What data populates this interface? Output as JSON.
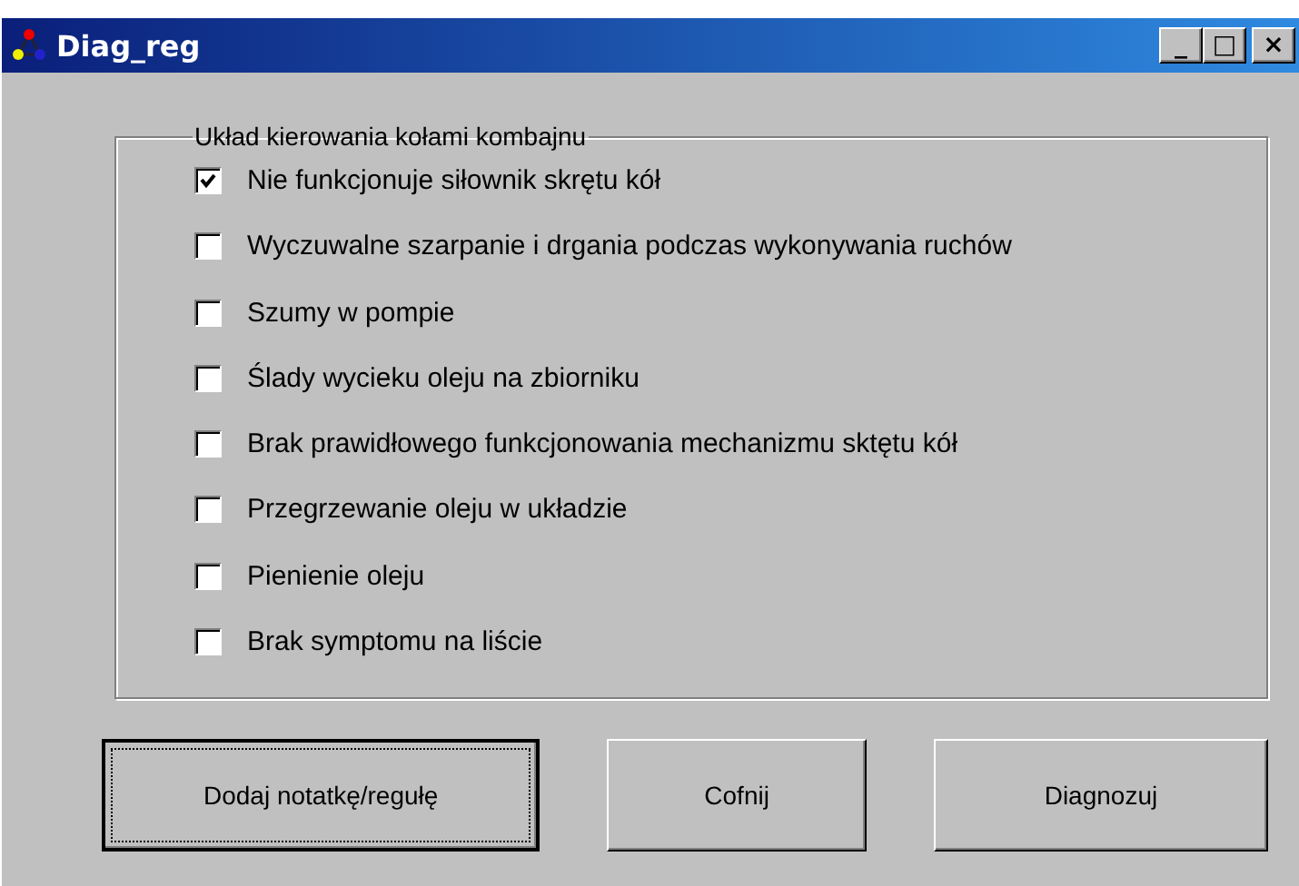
{
  "window": {
    "title": "Diag_reg",
    "controls": [
      "_",
      "□",
      "×"
    ]
  },
  "group": {
    "title": "Układ kierowania kołami kombajnu",
    "options": [
      {
        "label": "Nie funkcjonuje siłownik skrętu kół",
        "checked": true
      },
      {
        "label": "Wyczuwalne szarpanie i drgania podczas wykonywania ruchów",
        "checked": false
      },
      {
        "label": "Szumy w pompie",
        "checked": false
      },
      {
        "label": "Ślady wycieku oleju na zbiorniku",
        "checked": false
      },
      {
        "label": "Brak prawidłowego funkcjonowania mechanizmu sktętu kół",
        "checked": false
      },
      {
        "label": "Przegrzewanie oleju w układzie",
        "checked": false
      },
      {
        "label": "Pienienie oleju",
        "checked": false
      },
      {
        "label": "Brak symptomu na liście",
        "checked": false
      }
    ]
  },
  "buttons": [
    {
      "label": "Dodaj notatkę/regułę",
      "focused": true
    },
    {
      "label": "Cofnij",
      "focused": false
    },
    {
      "label": "Diagnozuj",
      "focused": false
    }
  ]
}
